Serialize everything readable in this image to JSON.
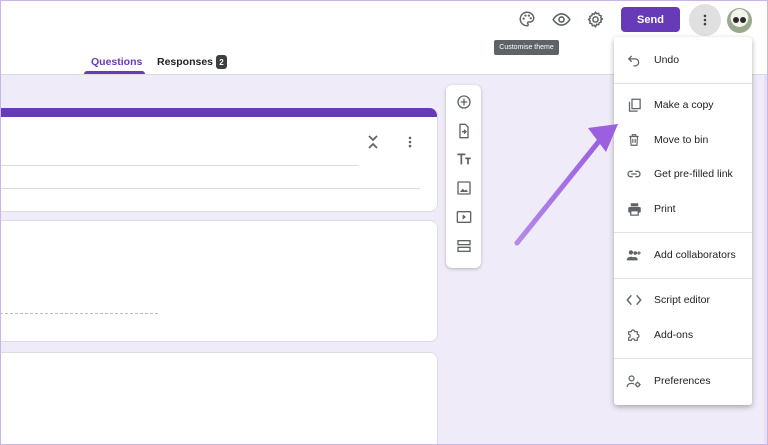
{
  "header": {
    "send_label": "Send",
    "tooltip": "Customise theme",
    "icons": [
      "palette-icon",
      "eye-icon",
      "gear-icon",
      "more-vert-icon"
    ]
  },
  "tabs": [
    {
      "label": "Questions",
      "active": true
    },
    {
      "label": "Responses",
      "active": false,
      "count": "2"
    }
  ],
  "menu": {
    "items": [
      {
        "label": "Undo",
        "icon": "undo-icon"
      },
      {
        "label": "Make a copy",
        "icon": "copy-icon"
      },
      {
        "label": "Move to bin",
        "icon": "trash-icon"
      },
      {
        "label": "Get pre-filled link",
        "icon": "link-icon"
      },
      {
        "label": "Print",
        "icon": "print-icon"
      },
      {
        "label": "Add collaborators",
        "icon": "add-people-icon"
      },
      {
        "label": "Script editor",
        "icon": "code-icon"
      },
      {
        "label": "Add-ons",
        "icon": "puzzle-icon"
      },
      {
        "label": "Preferences",
        "icon": "person-settings-icon"
      }
    ]
  },
  "toolbar": [
    "add-question-icon",
    "import-questions-icon",
    "add-title-icon",
    "add-image-icon",
    "add-video-icon",
    "add-section-icon"
  ],
  "colors": {
    "accent": "#673ab7",
    "background": "#f0ebf8",
    "arrow": "#a56fe0"
  }
}
